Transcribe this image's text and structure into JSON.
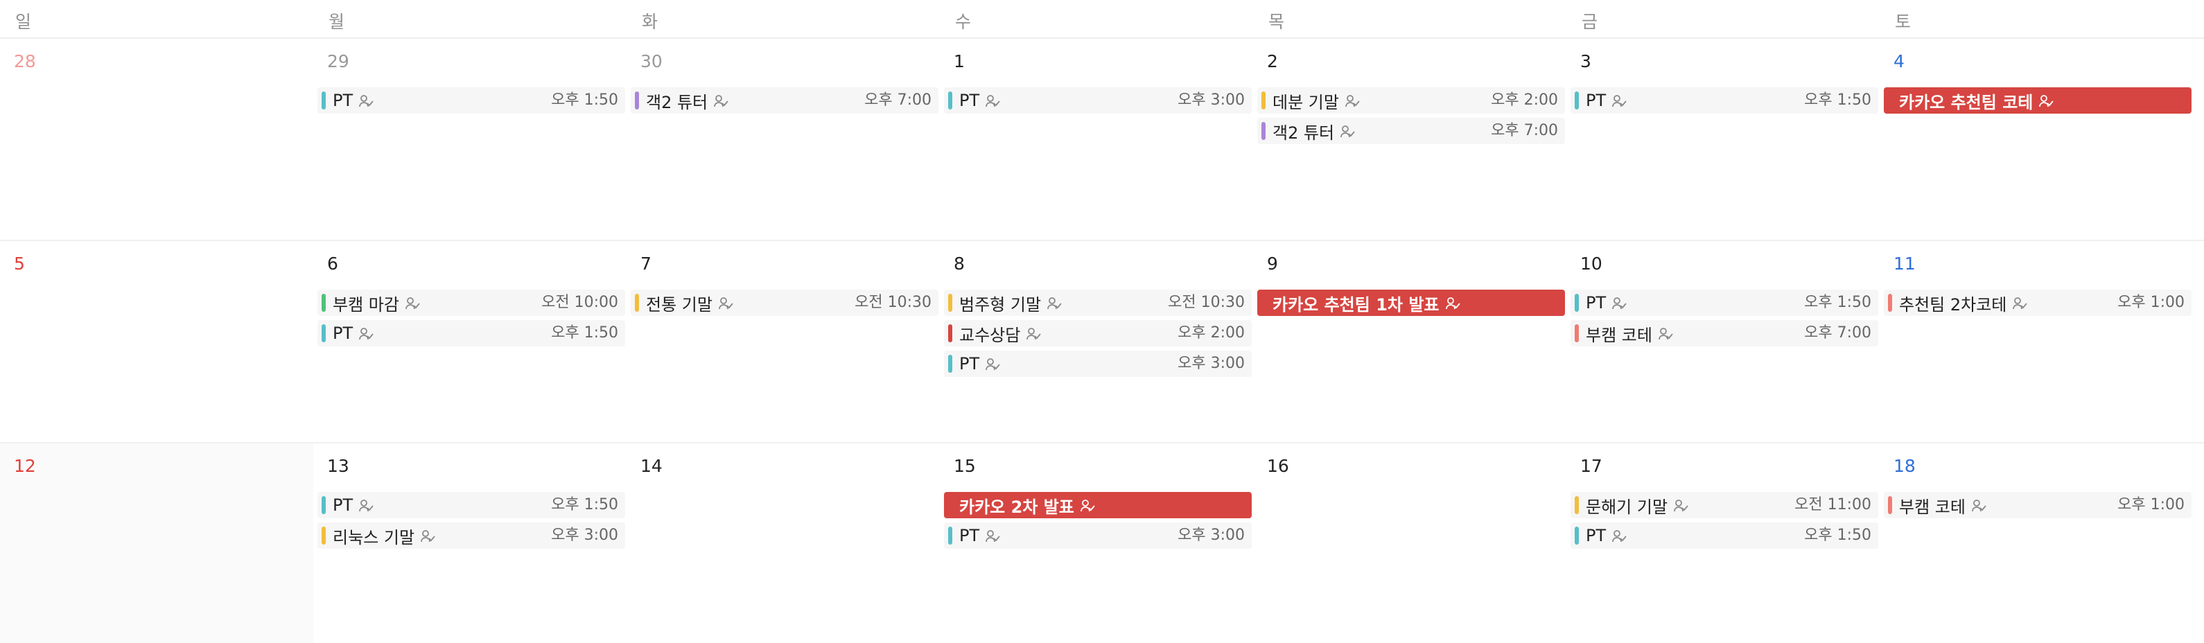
{
  "colors": {
    "teal": "#56bfc8",
    "purple": "#a885d9",
    "yellow": "#f2bd3b",
    "green": "#4fc37a",
    "coral": "#ef7c72",
    "red": "#d64541",
    "major_bg": "#d64541"
  },
  "weekdays": [
    "일",
    "월",
    "화",
    "수",
    "목",
    "금",
    "토"
  ],
  "weeks": [
    {
      "days": [
        {
          "num": "28",
          "other": true,
          "events": []
        },
        {
          "num": "29",
          "other": true,
          "events": [
            {
              "title": "PT",
              "time": "오후 1:50",
              "color": "teal",
              "icon": "person-check-icon"
            }
          ]
        },
        {
          "num": "30",
          "other": true,
          "events": [
            {
              "title": "객2 튜터",
              "time": "오후 7:00",
              "color": "purple",
              "icon": "person-check-icon"
            }
          ]
        },
        {
          "num": "1",
          "events": [
            {
              "title": "PT",
              "time": "오후 3:00",
              "color": "teal",
              "icon": "person-check-icon"
            }
          ]
        },
        {
          "num": "2",
          "events": [
            {
              "title": "데분 기말",
              "time": "오후 2:00",
              "color": "yellow",
              "icon": "person-check-icon"
            },
            {
              "title": "객2 튜터",
              "time": "오후 7:00",
              "color": "purple",
              "icon": "person-check-icon"
            }
          ]
        },
        {
          "num": "3",
          "events": [
            {
              "title": "PT",
              "time": "오후 1:50",
              "color": "teal",
              "icon": "person-check-icon"
            }
          ]
        },
        {
          "num": "4",
          "events": [
            {
              "title": "카카오 추천팀 코테",
              "time": "",
              "color": "red",
              "major": true,
              "icon": "person-check-icon"
            }
          ]
        }
      ]
    },
    {
      "days": [
        {
          "num": "5",
          "events": []
        },
        {
          "num": "6",
          "events": [
            {
              "title": "부캠 마감",
              "time": "오전 10:00",
              "color": "green",
              "icon": "person-check-icon"
            },
            {
              "title": "PT",
              "time": "오후 1:50",
              "color": "teal",
              "icon": "person-check-icon"
            }
          ]
        },
        {
          "num": "7",
          "events": [
            {
              "title": "전통 기말",
              "time": "오전 10:30",
              "color": "yellow",
              "icon": "person-check-icon"
            }
          ]
        },
        {
          "num": "8",
          "events": [
            {
              "title": "범주형 기말",
              "time": "오전 10:30",
              "color": "yellow",
              "icon": "person-check-icon"
            },
            {
              "title": "교수상담",
              "time": "오후 2:00",
              "color": "red",
              "icon": "person-check-icon"
            },
            {
              "title": "PT",
              "time": "오후 3:00",
              "color": "teal",
              "icon": "person-check-icon"
            }
          ]
        },
        {
          "num": "9",
          "events": [
            {
              "title": "카카오 추천팀 1차 발표",
              "time": "",
              "color": "red",
              "major": true,
              "icon": "person-check-icon"
            }
          ]
        },
        {
          "num": "10",
          "events": [
            {
              "title": "PT",
              "time": "오후 1:50",
              "color": "teal",
              "icon": "person-check-icon"
            },
            {
              "title": "부캠 코테",
              "time": "오후 7:00",
              "color": "coral",
              "icon": "person-check-icon"
            }
          ]
        },
        {
          "num": "11",
          "events": [
            {
              "title": "추천팀 2차코테",
              "time": "오후 1:00",
              "color": "coral",
              "icon": "person-check-icon"
            }
          ]
        }
      ]
    },
    {
      "days": [
        {
          "num": "12",
          "events": []
        },
        {
          "num": "13",
          "events": [
            {
              "title": "PT",
              "time": "오후 1:50",
              "color": "teal",
              "icon": "person-check-icon"
            },
            {
              "title": "리눅스 기말",
              "time": "오후 3:00",
              "color": "yellow",
              "icon": "person-check-icon"
            }
          ]
        },
        {
          "num": "14",
          "events": []
        },
        {
          "num": "15",
          "events": [
            {
              "title": "카카오 2차 발표",
              "time": "",
              "color": "red",
              "major": true,
              "icon": "person-check-icon"
            },
            {
              "title": "PT",
              "time": "오후 3:00",
              "color": "teal",
              "icon": "person-check-icon"
            }
          ]
        },
        {
          "num": "16",
          "events": []
        },
        {
          "num": "17",
          "events": [
            {
              "title": "문해기 기말",
              "time": "오전 11:00",
              "color": "yellow",
              "icon": "person-check-icon"
            },
            {
              "title": "PT",
              "time": "오후 1:50",
              "color": "teal",
              "icon": "person-check-icon"
            }
          ]
        },
        {
          "num": "18",
          "events": [
            {
              "title": "부캠 코테",
              "time": "오후 1:00",
              "color": "coral",
              "icon": "person-check-icon"
            }
          ]
        }
      ]
    }
  ]
}
